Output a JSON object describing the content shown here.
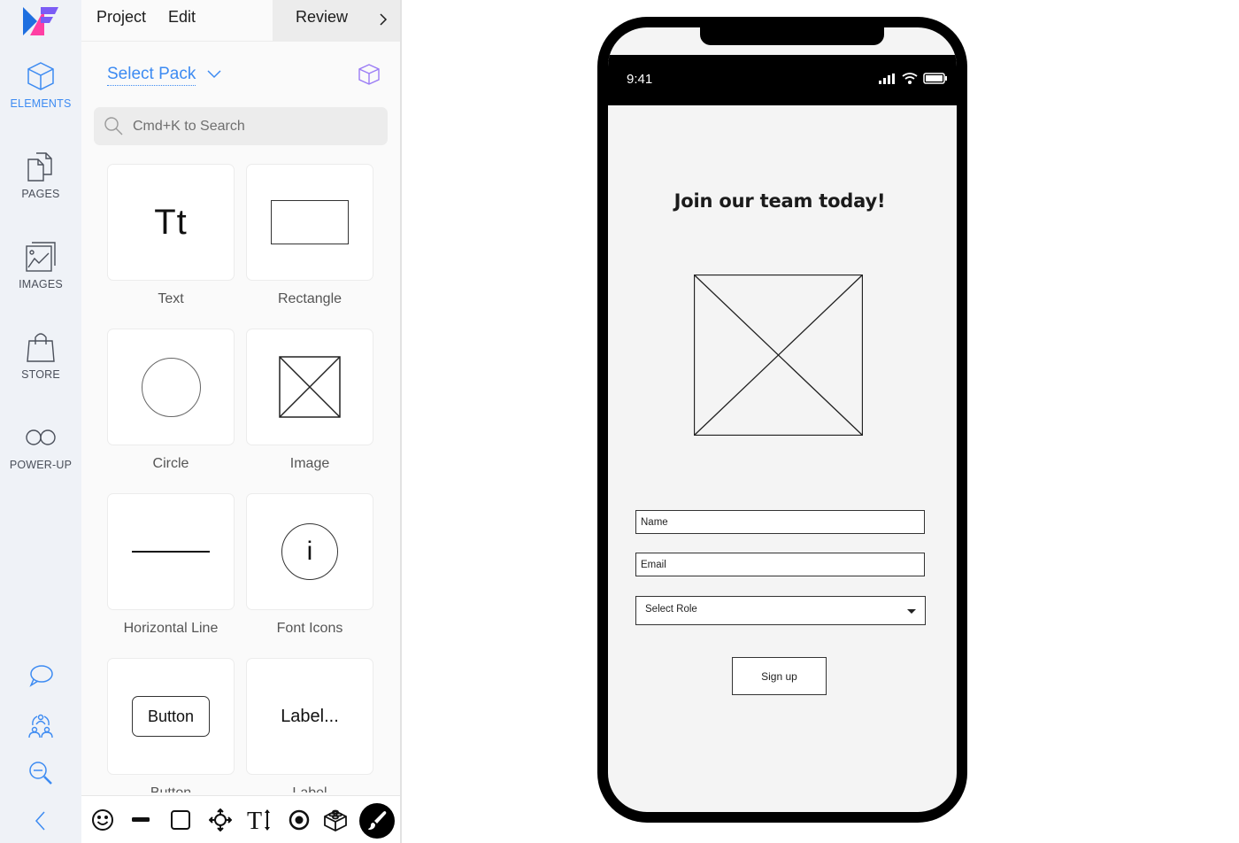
{
  "rail": {
    "items": [
      {
        "label": "ELEMENTS",
        "icon": "cube-icon",
        "active": true
      },
      {
        "label": "PAGES",
        "icon": "pages-icon"
      },
      {
        "label": "IMAGES",
        "icon": "image-icon"
      },
      {
        "label": "STORE",
        "icon": "shopping-bag-icon"
      },
      {
        "label": "POWER-UP",
        "icon": "infinity-icon"
      }
    ],
    "bottom": [
      "comment-icon",
      "collaborators-icon",
      "zoom-out-icon",
      "chevron-left-icon"
    ]
  },
  "topbar": {
    "menu": [
      "Project",
      "Edit"
    ],
    "review": "Review"
  },
  "panel": {
    "pack_label": "Select Pack",
    "search_placeholder": "Cmd+K to Search",
    "elements": [
      {
        "label": "Text",
        "preview": "Tt"
      },
      {
        "label": "Rectangle"
      },
      {
        "label": "Circle"
      },
      {
        "label": "Image"
      },
      {
        "label": "Horizontal Line"
      },
      {
        "label": "Font Icons",
        "preview": "i"
      },
      {
        "label": "Button",
        "preview": "Button"
      },
      {
        "label": "Label",
        "preview": "Label..."
      }
    ]
  },
  "toolbar": {
    "tools": [
      "emoji-icon",
      "line-icon",
      "square-icon",
      "move-icon",
      "text-resize-icon",
      "radio-icon",
      "lego-icon",
      "brush-icon"
    ]
  },
  "phone": {
    "time": "9:41",
    "headline": "Join our team today!",
    "name_placeholder": "Name",
    "email_placeholder": "Email",
    "role_placeholder": "Select Role",
    "signup_label": "Sign up"
  },
  "colors": {
    "accent": "#3d8bf2",
    "purple": "#9b7cf5",
    "logo_blue": "#1e6fe0",
    "logo_pink": "#ff3fa4",
    "logo_violet": "#7b5cf5"
  }
}
